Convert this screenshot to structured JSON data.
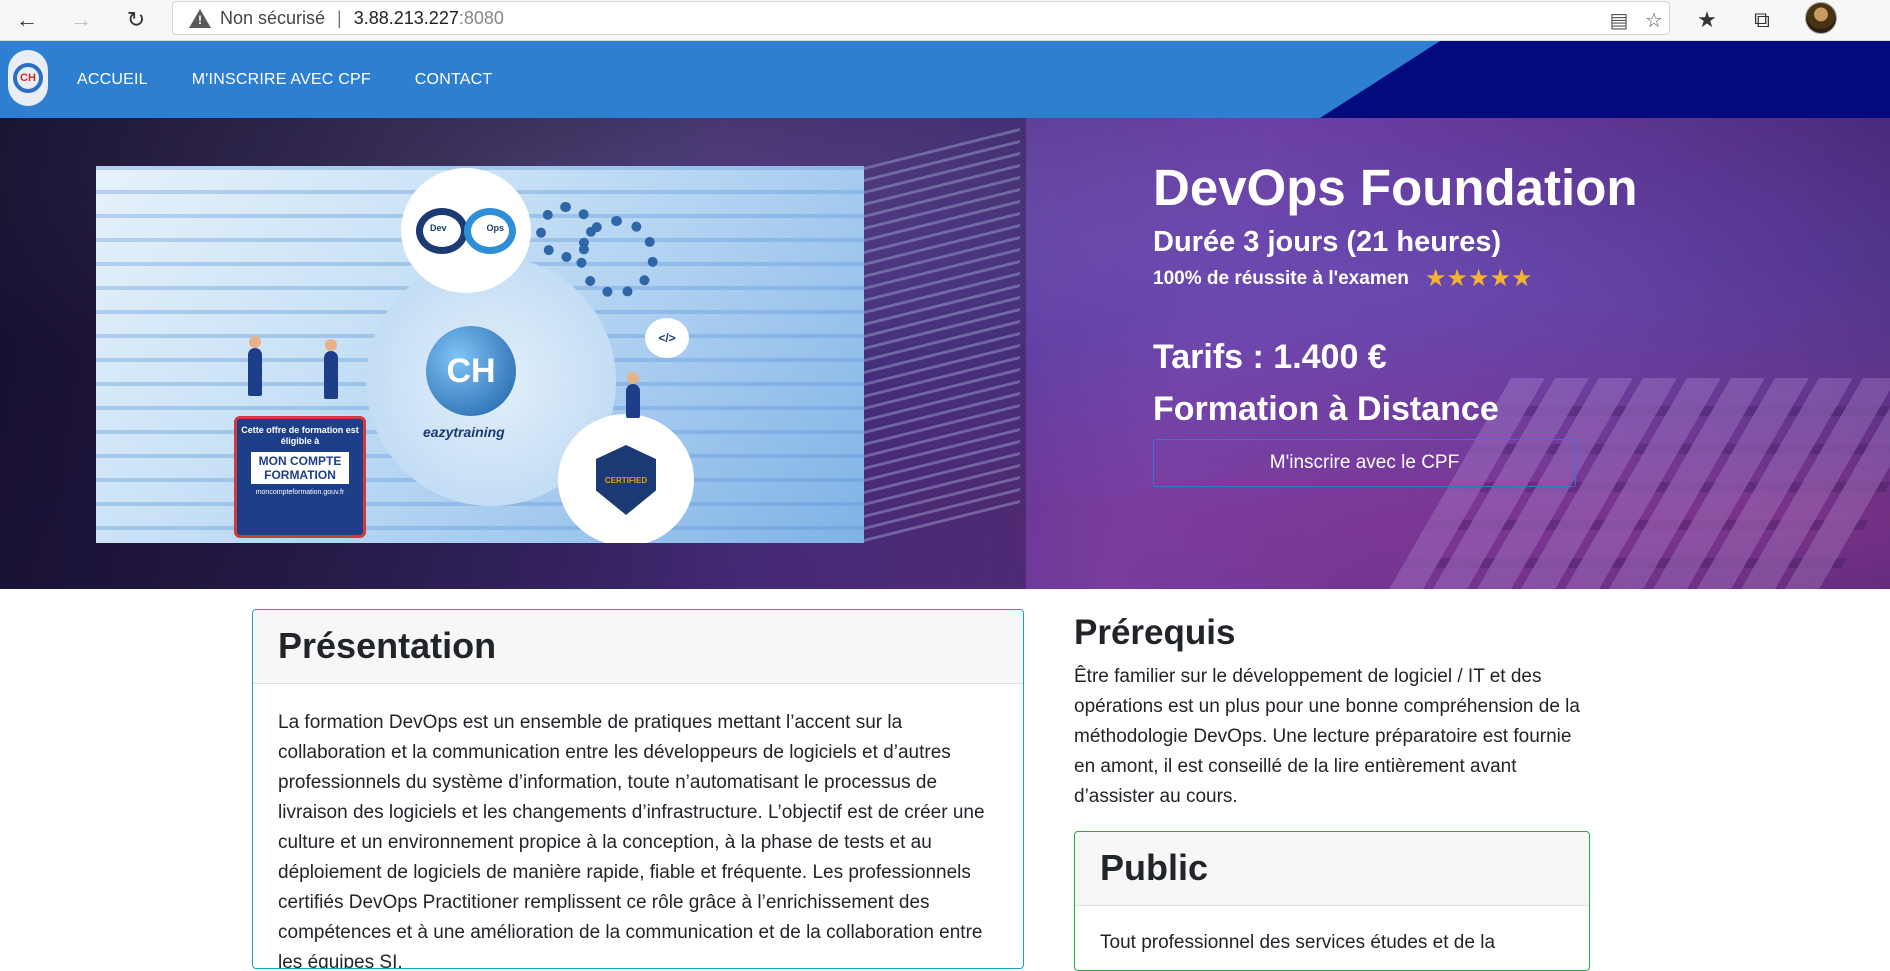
{
  "browser": {
    "security_label": "Non sécurisé",
    "url_host": "3.88.213.227",
    "url_port": ":8080"
  },
  "nav": {
    "items": [
      {
        "label": "ACCUEIL"
      },
      {
        "label": "M'INSCRIRE AVEC CPF"
      },
      {
        "label": "CONTACT"
      }
    ]
  },
  "hero": {
    "image": {
      "devops_left": "Dev",
      "devops_right": "Ops",
      "brand": "eazytraining",
      "code_tag": "</>",
      "cpf_offer": "Cette offre de formation est éligible à",
      "cpf_brand": "MON COMPTE FORMATION",
      "cpf_url": "moncompteformation.gouv.fr",
      "cert_text": "CERTIFIED"
    },
    "title": "DevOps Foundation",
    "duration": "Durée 3 jours (21 heures)",
    "success": "100% de réussite à l'examen",
    "rating_stars": "★★★★★",
    "price": "Tarifs : 1.400 €",
    "mode": "Formation à Distance",
    "cta_label": "M'inscrire avec le CPF"
  },
  "presentation": {
    "title": "Présentation",
    "text": "La formation DevOps est un ensemble de pratiques mettant l’accent sur la collaboration et la communication entre les développeurs de logiciels et d’autres professionnels du système d’information, toute n’automatisant le processus de livraison des logiciels et les changements d’infrastructure. L’objectif est de créer une culture et un environnement propice à la conception, à la phase de tests et au déploiement de logiciels de manière rapide, fiable et fréquente. Les professionnels certifiés DevOps Practitioner remplissent ce rôle grâce à l’enrichissement des compétences et à une amélioration de la communication et de la collaboration entre les équipes SI."
  },
  "prerequis": {
    "title": "Prérequis",
    "text": "Être familier sur le développement de logiciel / IT et des opérations est un plus pour une bonne compréhension de la méthodologie DevOps. Une lecture préparatoire est fournie en amont, il est conseillé de la lire entièrement avant d’assister au cours."
  },
  "public": {
    "title": "Public",
    "text": "Tout professionnel des services études et de la"
  },
  "colors": {
    "nav_blue": "#2f7fd0",
    "nav_dark": "#020a7e",
    "star": "#f2b233",
    "card_info_border": "#17a2b8",
    "card_success_border": "#28a745"
  }
}
